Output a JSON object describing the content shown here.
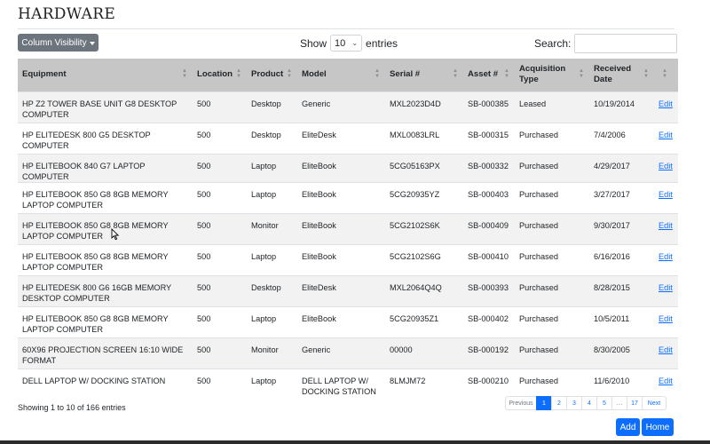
{
  "page": {
    "title": "HARDWARE"
  },
  "toolbar": {
    "column_visibility_label": "Column Visibility",
    "show_label": "Show",
    "entries_value": "10",
    "entries_label": "entries",
    "search_label": "Search:",
    "search_value": ""
  },
  "table": {
    "columns": [
      "Equipment",
      "Location",
      "Product",
      "Model",
      "Serial #",
      "Asset #",
      "Acquisition Type",
      "Received Date",
      ""
    ],
    "rows": [
      {
        "equipment": "HP Z2 TOWER BASE UNIT G8 DESKTOP COMPUTER",
        "location": "500",
        "product": "Desktop",
        "model": "Generic",
        "serial": "MXL2023D4D",
        "asset": "SB-000385",
        "acquisition": "Leased",
        "received": "10/19/2014",
        "action": "Edit"
      },
      {
        "equipment": "HP ELITEDESK 800 G5 DESKTOP COMPUTER",
        "location": "500",
        "product": "Desktop",
        "model": "EliteDesk",
        "serial": "MXL0083LRL",
        "asset": "SB-000315",
        "acquisition": "Purchased",
        "received": "7/4/2006",
        "action": "Edit"
      },
      {
        "equipment": "HP ELITEBOOK 840 G7 LAPTOP COMPUTER",
        "location": "500",
        "product": "Laptop",
        "model": "EliteBook",
        "serial": "5CG05163PX",
        "asset": "SB-000332",
        "acquisition": "Purchased",
        "received": "4/29/2017",
        "action": "Edit"
      },
      {
        "equipment": "HP ELITEBOOK 850 G8 8GB MEMORY LAPTOP COMPUTER",
        "location": "500",
        "product": "Laptop",
        "model": "EliteBook",
        "serial": "5CG20935YZ",
        "asset": "SB-000403",
        "acquisition": "Purchased",
        "received": "3/27/2017",
        "action": "Edit"
      },
      {
        "equipment": "HP ELITEBOOK 850 G8 8GB MEMORY LAPTOP COMPUTER",
        "location": "500",
        "product": "Monitor",
        "model": "EliteBook",
        "serial": "5CG2102S6K",
        "asset": "SB-000409",
        "acquisition": "Purchased",
        "received": "9/30/2017",
        "action": "Edit"
      },
      {
        "equipment": "HP ELITEBOOK 850 G8 8GB MEMORY LAPTOP COMPUTER",
        "location": "500",
        "product": "Laptop",
        "model": "EliteBook",
        "serial": "5CG2102S6G",
        "asset": "SB-000410",
        "acquisition": "Purchased",
        "received": "6/16/2016",
        "action": "Edit"
      },
      {
        "equipment": "HP ELITEDESK 800 G6 16GB MEMORY DESKTOP COMPUTER",
        "location": "500",
        "product": "Desktop",
        "model": "EliteDesk",
        "serial": "MXL2064Q4Q",
        "asset": "SB-000393",
        "acquisition": "Purchased",
        "received": "8/28/2015",
        "action": "Edit"
      },
      {
        "equipment": "HP ELITEBOOK 850 G8 8GB MEMORY LAPTOP COMPUTER",
        "location": "500",
        "product": "Laptop",
        "model": "EliteBook",
        "serial": "5CG20935Z1",
        "asset": "SB-000402",
        "acquisition": "Purchased",
        "received": "10/5/2011",
        "action": "Edit"
      },
      {
        "equipment": "60X96 PROJECTION SCREEN 16:10 WIDE FORMAT",
        "location": "500",
        "product": "Monitor",
        "model": "Generic",
        "serial": "00000",
        "asset": "SB-000192",
        "acquisition": "Purchased",
        "received": "8/30/2005",
        "action": "Edit"
      },
      {
        "equipment": "DELL LAPTOP W/ DOCKING STATION",
        "location": "500",
        "product": "Laptop",
        "model": "DELL LAPTOP W/ DOCKING STATION",
        "serial": "8LMJM72",
        "asset": "SB-000210",
        "acquisition": "Purchased",
        "received": "11/6/2010",
        "action": "Edit"
      }
    ]
  },
  "footer": {
    "info": "Showing 1 to 10 of 166 entries",
    "pagination": {
      "previous": "Previous",
      "pages": [
        "1",
        "2",
        "3",
        "4",
        "5",
        "…",
        "17"
      ],
      "active": "1",
      "next": "Next"
    },
    "add_label": "Add",
    "home_label": "Home"
  },
  "colors": {
    "header_bg": "#c6c6c6",
    "odd_row_bg": "#f2f2f2",
    "primary": "#0d6efd",
    "secondary_button": "#6c757d"
  },
  "icons": {
    "sort": "sort-arrows-icon",
    "dropdown": "caret-down-icon",
    "cursor": "mouse-pointer-icon"
  }
}
